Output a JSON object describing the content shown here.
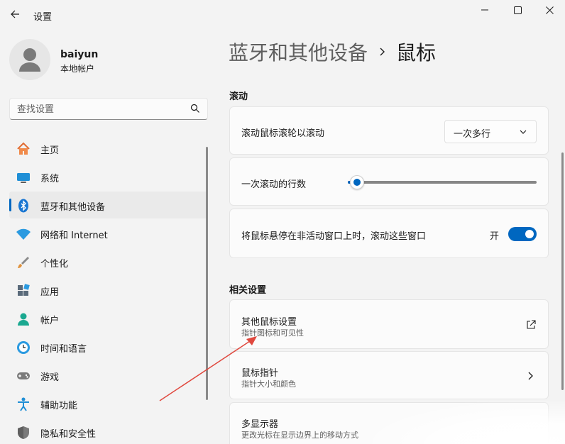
{
  "window": {
    "title": "设置"
  },
  "user": {
    "name": "baiyun",
    "account_type": "本地帐户"
  },
  "search": {
    "placeholder": "查找设置"
  },
  "nav": {
    "items": [
      {
        "label": "主页",
        "icon": "home-icon"
      },
      {
        "label": "系统",
        "icon": "system-icon"
      },
      {
        "label": "蓝牙和其他设备",
        "icon": "bluetooth-icon",
        "active": true
      },
      {
        "label": "网络和 Internet",
        "icon": "wifi-icon"
      },
      {
        "label": "个性化",
        "icon": "brush-icon"
      },
      {
        "label": "应用",
        "icon": "apps-icon"
      },
      {
        "label": "帐户",
        "icon": "account-icon"
      },
      {
        "label": "时间和语言",
        "icon": "time-language-icon"
      },
      {
        "label": "游戏",
        "icon": "gamepad-icon"
      },
      {
        "label": "辅助功能",
        "icon": "accessibility-icon"
      },
      {
        "label": "隐私和安全性",
        "icon": "shield-icon"
      }
    ]
  },
  "breadcrumb": {
    "parent": "蓝牙和其他设备",
    "current": "鼠标"
  },
  "scroll_section": {
    "title": "滚动",
    "wheel_label": "滚动鼠标滚轮以滚动",
    "wheel_value": "一次多行",
    "lines_label": "一次滚动的行数",
    "lines_level": 0.05,
    "inactive_label": "将鼠标悬停在非活动窗口上时，滚动这些窗口",
    "inactive_state": "开"
  },
  "related_section": {
    "title": "相关设置",
    "items": [
      {
        "label": "其他鼠标设置",
        "sub": "指针图标和可见性",
        "action_icon": "external-link-icon"
      },
      {
        "label": "鼠标指针",
        "sub": "指针大小和颜色",
        "action_icon": "chevron-right-icon"
      },
      {
        "label": "多显示器",
        "sub": "更改光标在显示边界上的移动方式"
      }
    ]
  },
  "colors": {
    "accent": "#0067c0",
    "annotation_arrow": "#e0483e"
  }
}
